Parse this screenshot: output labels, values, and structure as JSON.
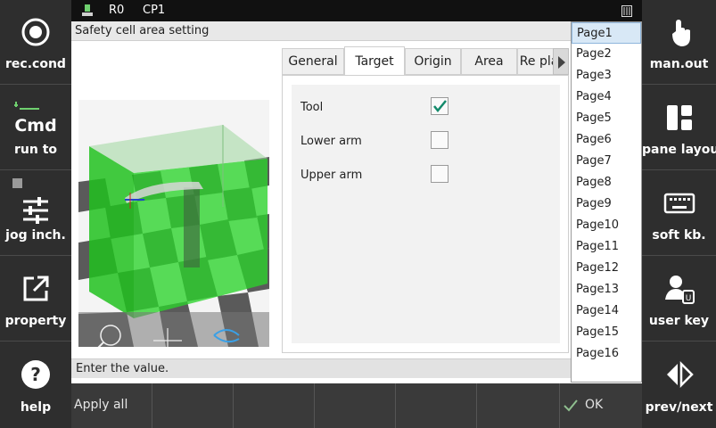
{
  "left_panel": {
    "items": [
      {
        "label": "rec.cond",
        "icon": "record-circle-icon"
      },
      {
        "label": "Cmd",
        "sub": "run to",
        "icon": "step-down-icon"
      },
      {
        "label": "jog inch.",
        "icon": "sliders-icon"
      },
      {
        "label": "property",
        "icon": "open-external-icon"
      },
      {
        "label": "help",
        "icon": "help-icon"
      }
    ]
  },
  "right_panel": {
    "items": [
      {
        "label": "man.out",
        "icon": "hand-pointer-icon"
      },
      {
        "label": "pane layout",
        "icon": "pane-layout-icon"
      },
      {
        "label": "soft kb.",
        "icon": "keyboard-icon"
      },
      {
        "label": "user key",
        "icon": "user-key-icon"
      },
      {
        "label": "prev/next",
        "icon": "prev-next-icon"
      }
    ]
  },
  "status_bar": {
    "robot": "R0",
    "program": "CP1"
  },
  "window": {
    "title": "Safety cell area setting",
    "tabs": [
      "General",
      "Target",
      "Origin",
      "Area",
      "Re plan"
    ],
    "active_tab": "Target",
    "rows": [
      {
        "label": "Tool",
        "checked": true
      },
      {
        "label": "Lower arm",
        "checked": false
      },
      {
        "label": "Upper arm",
        "checked": false
      }
    ],
    "status_message": "Enter the value."
  },
  "page_list": {
    "items": [
      "Page1",
      "Page2",
      "Page3",
      "Page4",
      "Page5",
      "Page6",
      "Page7",
      "Page8",
      "Page9",
      "Page10",
      "Page11",
      "Page12",
      "Page13",
      "Page14",
      "Page15",
      "Page16"
    ],
    "selected": "Page1"
  },
  "bottom_bar": {
    "apply_all": "Apply all",
    "ok": "OK"
  },
  "colors": {
    "accent_green": "#22c322",
    "check_green": "#138a6b",
    "selected_page": "#d8e8f6"
  }
}
